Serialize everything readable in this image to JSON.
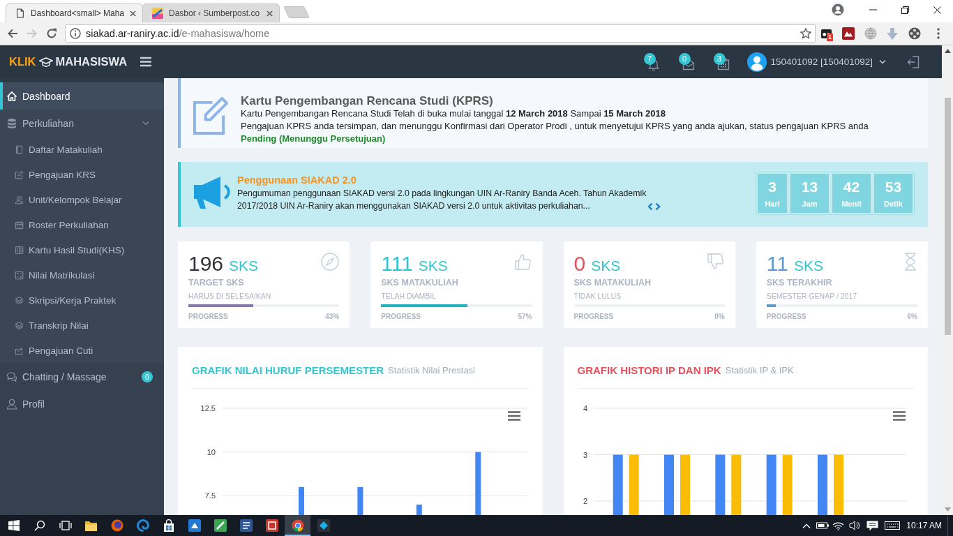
{
  "browser": {
    "tabs": [
      {
        "title": "Dashboard<small> Maha",
        "selected": true
      },
      {
        "title": "Dasbor ‹ Sumberpost.co",
        "selected": false
      }
    ],
    "back": {
      "disabled": false
    },
    "forward": {
      "disabled": true
    },
    "address": {
      "host": "siakad.ar-raniry.ac.id",
      "path": "/e-mahasiswa/home"
    },
    "extension_badge": "1"
  },
  "header": {
    "logo_first": "KLIK",
    "logo_second": "MAHASISWA",
    "notifications": "7",
    "messages": "0",
    "tasks": "3",
    "user": "150401092 [150401092]"
  },
  "sidebar": {
    "items": [
      {
        "label": "Dashboard",
        "selected": true
      },
      {
        "label": "Perkuliahan",
        "selected": false,
        "expanded": true,
        "children": [
          {
            "label": "Daftar Matakuliah",
            "selected": false
          },
          {
            "label": "Pengajuan KRS",
            "selected": false
          },
          {
            "label": "Unit/Kelompok Belajar",
            "selected": false
          },
          {
            "label": "Roster Perkuliahan",
            "selected": false
          },
          {
            "label": "Kartu Hasil Studi(KHS)",
            "selected": false
          },
          {
            "label": "Nilai Matrikulasi",
            "selected": false
          },
          {
            "label": "Skripsi/Kerja Praktek",
            "selected": false
          },
          {
            "label": "Transkrip Nilai",
            "selected": false
          },
          {
            "label": "Pengajuan Cuti",
            "selected": false
          }
        ]
      },
      {
        "label": "Chatting / Massage",
        "badge": "0",
        "selected": false
      },
      {
        "label": "Profil",
        "selected": false
      }
    ]
  },
  "notice": {
    "title": "Kartu Pengembangan Rencana Studi (KPRS)",
    "line_1": "Kartu Pengembangan Rencana Studi Telah di buka mulai tanggal **12 March 2018** Sampai **15 March 2018**",
    "line_2": "Pengajuan KPRS anda tersimpan, dan menunggu Konfirmasi dari Operator Prodi , untuk menyetujui KPRS yang anda ajukan, status pengajuan KPRS anda",
    "status": "Pending (Menunggu Persetujuan)"
  },
  "announcement": {
    "title": "Penggunaan SIAKAD 2.0",
    "text": "Pengumuman penggunaan SIAKAD versi 2.0 pada lingkungan UIN Ar-Raniry Banda Aceh. Tahun Akademik 2017/2018 UIN Ar-Raniry akan menggunakan SIAKAD versi 2.0 untuk aktivitas perkuliahan...",
    "countdown": [
      {
        "value": "3",
        "label": "Hari"
      },
      {
        "value": "13",
        "label": "Jam"
      },
      {
        "value": "42",
        "label": "Menit"
      },
      {
        "value": "53",
        "label": "Detik"
      }
    ]
  },
  "stats": [
    {
      "value": {
        "text": "196",
        "color": "#2f353b"
      },
      "unit": "SKS",
      "title": "TARGET SKS",
      "subtitle": "HARUS DI SELESAIKAN",
      "progress": {
        "label": "PROGRESS",
        "percent": "43%",
        "level": 0.43,
        "color": "#8877a9"
      }
    },
    {
      "value": {
        "text": "111",
        "color": "#32c5d2"
      },
      "unit": "SKS",
      "title": "SKS MATAKULIAH",
      "subtitle": "TELAH DIAMBIL",
      "progress": {
        "label": "PROGRESS",
        "percent": "57%",
        "level": 0.57,
        "color": "#1fb3bf"
      }
    },
    {
      "value": {
        "text": "0",
        "color": "#e7505a"
      },
      "unit": "SKS",
      "title": "SKS MATAKULIAH",
      "subtitle": "TIDAK LULUS",
      "progress": {
        "label": "PROGRESS",
        "percent": "0%"
      }
    },
    {
      "value": {
        "text": "11",
        "color": "#5c9bd1"
      },
      "unit": "SKS",
      "title": "SKS TERAKHIR",
      "subtitle": "SEMESTER GENAP / 2017",
      "progress": {
        "label": "PROGRESS",
        "percent": "6%",
        "level": 0.06,
        "color": "#5c9bd1"
      }
    }
  ],
  "charts": [
    {
      "title": "GRAFIK NILAI HURUF PERSEMESTER",
      "subtitle": "Statistik Nilai Prestasi",
      "color": "#32c5d2",
      "chart_data": [
        {
          "type": "bar",
          "categories": [
            null,
            null,
            null,
            null
          ],
          "values": [
            8,
            8,
            7,
            10
          ],
          "color": "#4285f4",
          "yticks": [
            7.5,
            10,
            12.5
          ],
          "ylim": [
            6.4,
            12.5
          ],
          "grid": true
        }
      ]
    },
    {
      "title": "GRAFIK HISTORI IP DAN IPK",
      "subtitle": "Statistik IP & IPK",
      "color": "#e7505a",
      "chart_data": [
        {
          "type": "bar",
          "categories": [
            null,
            null,
            null,
            null,
            null
          ],
          "series": [
            {
              "color": "#4285f4",
              "values": [
                3,
                3,
                3,
                3,
                3
              ]
            },
            {
              "color": "#fbbc04",
              "values": [
                3,
                3,
                3,
                3,
                3
              ]
            }
          ],
          "yticks": [
            2,
            3,
            4
          ],
          "ylim": [
            1.7,
            4
          ],
          "grid": true
        }
      ]
    }
  ],
  "taskbar": {
    "apps": [
      {
        "selected": false
      },
      {
        "selected": false
      },
      {
        "selected": false
      },
      {
        "selected": false
      },
      {
        "selected": false
      },
      {
        "selected": false
      },
      {
        "selected": false
      },
      {
        "selected": false
      },
      {
        "selected": true
      },
      {
        "selected": false
      }
    ],
    "clock": "10:17 AM"
  }
}
